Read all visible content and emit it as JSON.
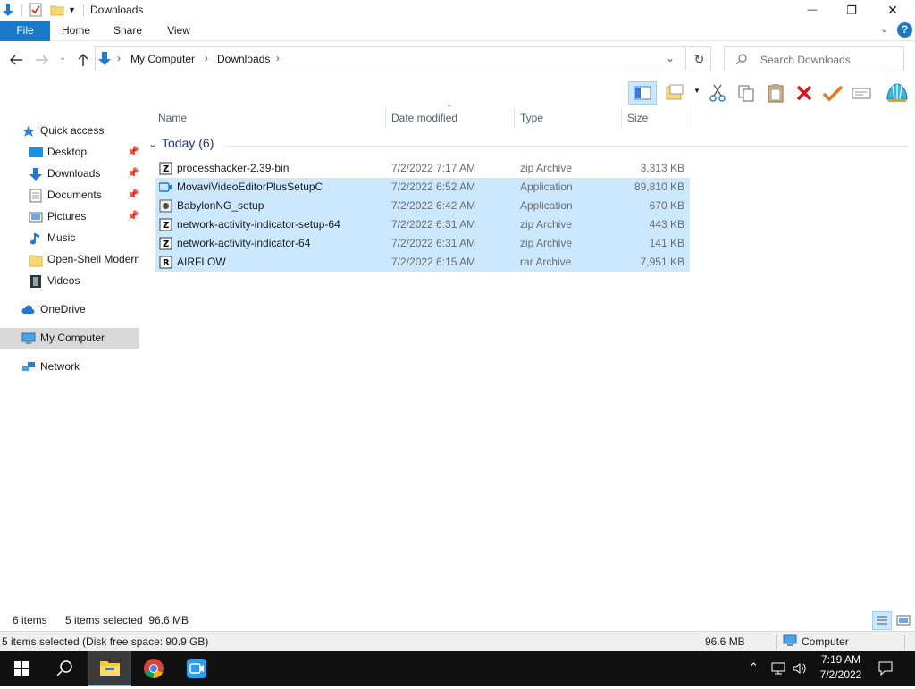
{
  "window": {
    "title": "Downloads",
    "controls": {
      "minimize": "—",
      "restore": "❐",
      "close": "✕"
    }
  },
  "ribbon": {
    "tabs": [
      "File",
      "Home",
      "Share",
      "View"
    ],
    "help": "?"
  },
  "address": {
    "path": [
      "My Computer",
      "Downloads"
    ],
    "search_placeholder": "Search Downloads"
  },
  "nav": {
    "items": [
      {
        "label": "Quick access",
        "icon": "star-icon",
        "pinned": false
      },
      {
        "label": "Desktop",
        "icon": "desktop-icon",
        "pinned": true
      },
      {
        "label": "Downloads",
        "icon": "download-arrow-icon",
        "pinned": true
      },
      {
        "label": "Documents",
        "icon": "document-icon",
        "pinned": true
      },
      {
        "label": "Pictures",
        "icon": "picture-icon",
        "pinned": true
      },
      {
        "label": "Music",
        "icon": "music-note-icon",
        "pinned": false
      },
      {
        "label": "Open-Shell Modern",
        "icon": "folder-icon",
        "pinned": false
      },
      {
        "label": "Videos",
        "icon": "film-icon",
        "pinned": false
      },
      {
        "label": "OneDrive",
        "icon": "cloud-icon",
        "pinned": false
      },
      {
        "label": "My Computer",
        "icon": "computer-icon",
        "pinned": false
      },
      {
        "label": "Network",
        "icon": "network-icon",
        "pinned": false
      }
    ],
    "selected": "My Computer"
  },
  "columns": [
    "Name",
    "Date modified",
    "Type",
    "Size"
  ],
  "group": {
    "label": "Today (6)"
  },
  "files": [
    {
      "name": "processhacker-2.39-bin",
      "date": "7/2/2022 7:17 AM",
      "type": "zip Archive",
      "size": "3,313 KB",
      "selected": false,
      "icon": "zip-icon"
    },
    {
      "name": "MovaviVideoEditorPlusSetupC",
      "date": "7/2/2022 6:52 AM",
      "type": "Application",
      "size": "89,810 KB",
      "selected": true,
      "icon": "app-icon"
    },
    {
      "name": "BabylonNG_setup",
      "date": "7/2/2022 6:42 AM",
      "type": "Application",
      "size": "670 KB",
      "selected": true,
      "icon": "installer-icon"
    },
    {
      "name": "network-activity-indicator-setup-64",
      "date": "7/2/2022 6:31 AM",
      "type": "zip Archive",
      "size": "443 KB",
      "selected": true,
      "icon": "zip-icon"
    },
    {
      "name": "network-activity-indicator-64",
      "date": "7/2/2022 6:31 AM",
      "type": "zip Archive",
      "size": "141 KB",
      "selected": true,
      "icon": "zip-icon"
    },
    {
      "name": "AIRFLOW",
      "date": "7/2/2022 6:15 AM",
      "type": "rar Archive",
      "size": "7,951 KB",
      "selected": true,
      "icon": "rar-icon"
    }
  ],
  "status": {
    "items_count": "6 items",
    "selected_info": "5 items selected  96.6 MB",
    "disk_info": "5 items selected (Disk free space: 90.9 GB)",
    "size_total": "96.6 MB",
    "location": "Computer"
  },
  "taskbar": {
    "time": "7:19 AM",
    "date": "7/2/2022"
  },
  "colors": {
    "accent": "#1979ca",
    "selection": "#cce8ff",
    "group_header": "#1e3287"
  }
}
